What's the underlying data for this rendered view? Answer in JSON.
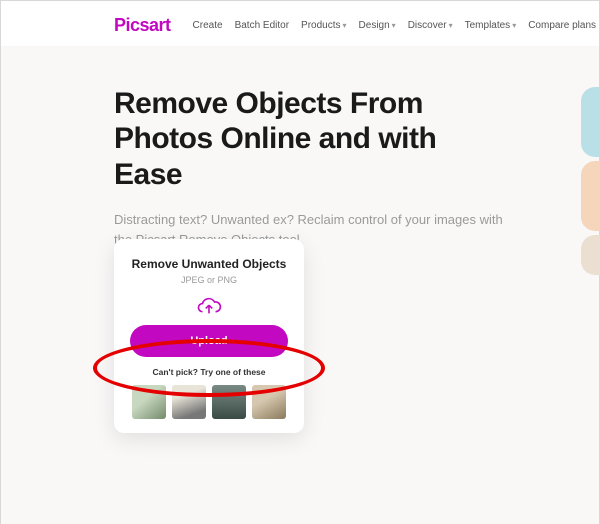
{
  "header": {
    "logo": "Picsart",
    "nav": [
      {
        "label": "Create",
        "dropdown": false
      },
      {
        "label": "Batch Editor",
        "dropdown": false
      },
      {
        "label": "Products",
        "dropdown": true
      },
      {
        "label": "Design",
        "dropdown": true
      },
      {
        "label": "Discover",
        "dropdown": true
      },
      {
        "label": "Templates",
        "dropdown": true
      },
      {
        "label": "Compare plans",
        "dropdown": false
      }
    ]
  },
  "hero": {
    "title": "Remove Objects From Photos Online and with Ease",
    "subtitle": "Distracting text? Unwanted ex? Reclaim control of your images with the Picsart Remove Objects tool."
  },
  "card": {
    "title": "Remove Unwanted Objects",
    "hint": "JPEG or PNG",
    "upload_label": "Upload",
    "try_text": "Can't pick? Try one of these"
  },
  "colors": {
    "brand": "#c209c1",
    "annotation": "#e40000"
  }
}
